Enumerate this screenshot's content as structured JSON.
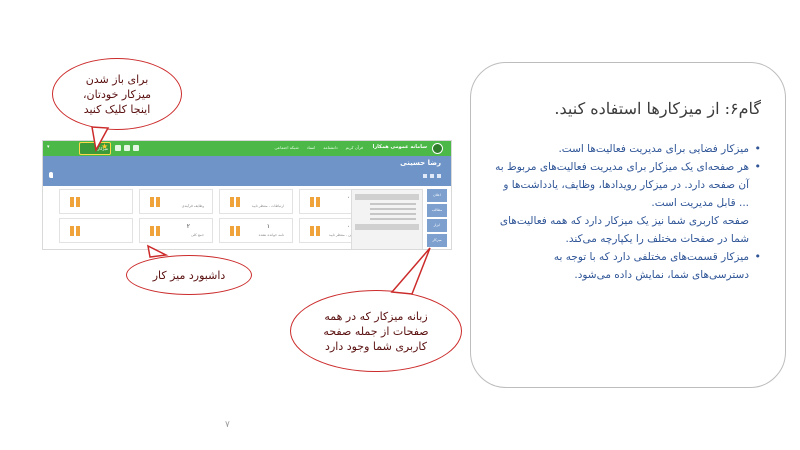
{
  "screenshot": {
    "brand": "سامانه عمومی همکارا",
    "menu": [
      "فرآن کریم",
      "دانشنامه",
      "اسناد",
      "شبکه اجتماعی"
    ],
    "user_label": "میزکار",
    "page_title": "رضا حسینی",
    "tiles": [
      {
        "num": "۰",
        "label": "رویدادها"
      },
      {
        "num": "",
        "label": "ارتباطات - منتظر تایید"
      },
      {
        "num": "",
        "label": "وظایف فرآیندی"
      },
      {
        "num": "",
        "label": ""
      },
      {
        "num": "۰",
        "label": "وظایف من - منتظر تایید"
      },
      {
        "num": "۱",
        "label": "نامه خوانده نشده"
      },
      {
        "num": "۲",
        "label": "جمع کلی"
      },
      {
        "num": "",
        "label": ""
      }
    ],
    "side_tabs": [
      "اعلان",
      "مطالب",
      "ابزار",
      "میزکار"
    ]
  },
  "callouts": {
    "open_desk": "برای باز شدن\nمیزکار خودتان،\nاینجا کلیک کنید",
    "dashboard": "داشبورد میز کار",
    "desk_tab": "زبانه میزکار که در همه\nصفحات از جمله صفحه\nکاربری شما وجود دارد"
  },
  "panel": {
    "title": "گام۶: از میزکارها استفاده کنید.",
    "bullets": [
      {
        "text": "میزکار فضایی برای مدیریت فعالیت‌ها است.",
        "dot": true
      },
      {
        "text": "هر صفحه‌ای یک میزکار برای مدیریت فعالیت‌های مربوط به آن صفحه دارد. در میزکار رویدادها، وظایف، یادداشت‌ها و ... قابل مدیریت است.",
        "dot": true
      },
      {
        "text": "صفحه کاربری شما نیز یک میزکار دارد که همه فعالیت‌های شما در صفحات مختلف را یکپارچه می‌کند.",
        "dot": false
      },
      {
        "text": "میزکار قسمت‌های مختلفی دارد که با توجه به دسترسی‌های شما، نمایش داده می‌شود.",
        "dot": true
      }
    ]
  },
  "page_number": "۷",
  "colors": {
    "green": "#4cb847",
    "blue": "#6f95c8",
    "callout_border": "#cc2b2b",
    "text_blue": "#2f5597"
  }
}
